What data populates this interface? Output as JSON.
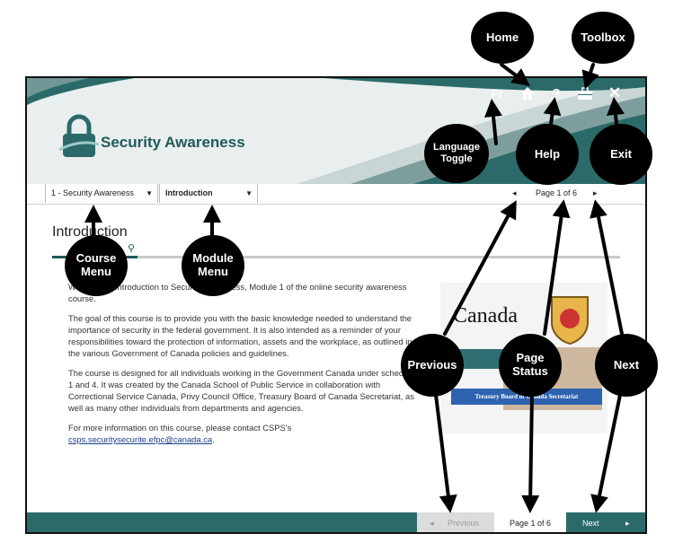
{
  "banner": {
    "title": "Security Awareness"
  },
  "top_icons": {
    "language": "Fr",
    "home": "home-icon",
    "help": "?",
    "toolbox": "toolbox-icon",
    "exit": "✕"
  },
  "nav": {
    "course_select": "1 - Security Awareness",
    "module_select": "Introduction",
    "prev_symbol": "◂",
    "page_status": "Page 1 of 6",
    "next_symbol": "▸"
  },
  "page": {
    "heading": "Introduction",
    "progress": 0.15,
    "paragraphs": [
      "Welcome to Introduction to Security Awareness, Module 1 of the online security awareness course.",
      "The goal of this course is to provide you with the basic knowledge needed to understand the importance of security in the federal government. It is also intended as a reminder of your responsibilities toward the protection of information, assets and the workplace, as outlined in the various Government of Canada policies and guidelines.",
      "The course is designed for all individuals working in the Government Canada under schedules 1 and 4. It was created by the Canada School of Public Service in collaboration with Correctional Service Canada, Privy Council Office, Treasury Board of Canada Secretariat, as well as many other individuals from departments and agencies."
    ],
    "contact_text": "For more information on this course, please contact CSPS's",
    "contact_email": "csps.securitysecurite.efpc@canada.ca",
    "contact_end": ".",
    "hero": {
      "wordmark": "Canada",
      "banner_text": "Treasury Board of Canada Secretariat"
    }
  },
  "footer": {
    "previous_label": "Previous",
    "previous_symbol": "◂",
    "page_status": "Page 1 of 6",
    "next_label": "Next",
    "next_symbol": "▸"
  },
  "callouts": {
    "home": "Home",
    "toolbox": "Toolbox",
    "language_line1": "Language",
    "language_line2": "Toggle",
    "help": "Help",
    "exit": "Exit",
    "course_line1": "Course",
    "course_line2": "Menu",
    "module_line1": "Module",
    "module_line2": "Menu",
    "previous": "Previous",
    "page_line1": "Page",
    "page_line2": "Status",
    "next": "Next"
  },
  "colors": {
    "teal": "#2b6a69",
    "title": "#1f5a59",
    "callout": "#000000"
  }
}
